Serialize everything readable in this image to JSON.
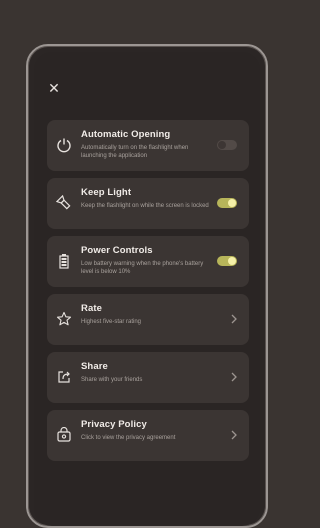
{
  "close_icon": "close-icon",
  "settings": [
    {
      "title": "Automatic Opening",
      "subtitle": "Automatically turn on the flashlight when launching the application",
      "icon": "power-icon",
      "control": "toggle",
      "on": false
    },
    {
      "title": "Keep Light",
      "subtitle": "Keep the flashlight on while the screen is locked",
      "icon": "flashlight-icon",
      "control": "toggle",
      "on": true
    },
    {
      "title": "Power Controls",
      "subtitle": "Low battery warning when the phone's battery level is below 10%",
      "icon": "battery-icon",
      "control": "toggle",
      "on": true
    },
    {
      "title": "Rate",
      "subtitle": "Highest five-star rating",
      "icon": "star-icon",
      "control": "chevron"
    },
    {
      "title": "Share",
      "subtitle": "Share with your friends",
      "icon": "share-icon",
      "control": "chevron"
    },
    {
      "title": "Privacy Policy",
      "subtitle": "Click to view the privacy agreement",
      "icon": "privacy-icon",
      "control": "chevron"
    }
  ],
  "colors": {
    "toggle_on": "#b7b55a",
    "card": "#3b3533",
    "background": "#2a2524"
  }
}
